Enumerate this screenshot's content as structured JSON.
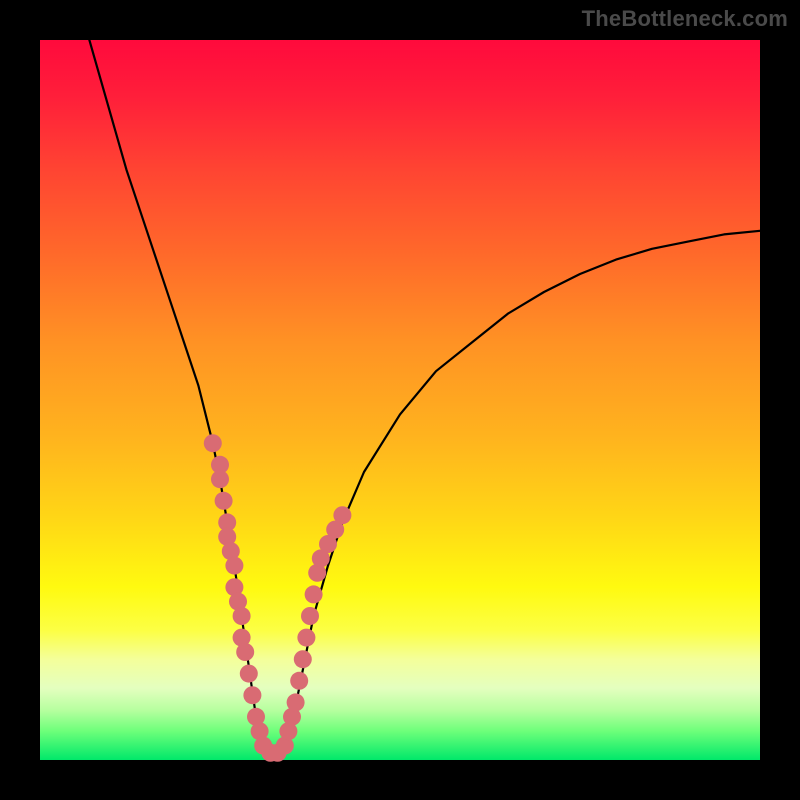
{
  "watermark": "TheBottleneck.com",
  "colors": {
    "background": "#000000",
    "curve": "#000000",
    "dots": "#d96b73",
    "gradient_top": "#ff0a3c",
    "gradient_bottom": "#00e86a"
  },
  "chart_data": {
    "type": "line",
    "title": "",
    "xlabel": "",
    "ylabel": "",
    "xlim": [
      0,
      100
    ],
    "ylim": [
      0,
      100
    ],
    "grid": false,
    "series": [
      {
        "name": "bottleneck-curve",
        "x": [
          6,
          8,
          10,
          12,
          14,
          16,
          18,
          20,
          22,
          24,
          25,
          26,
          27,
          28,
          29,
          30,
          31,
          32,
          33,
          34,
          35,
          36,
          37,
          38,
          40,
          42,
          45,
          50,
          55,
          60,
          65,
          70,
          75,
          80,
          85,
          90,
          95,
          100
        ],
        "values": [
          103,
          96,
          89,
          82,
          76,
          70,
          64,
          58,
          52,
          44,
          39,
          33,
          27,
          20,
          13,
          6,
          2,
          0.5,
          0.5,
          2,
          5,
          10,
          15,
          20,
          27,
          33,
          40,
          48,
          54,
          58,
          62,
          65,
          67.5,
          69.5,
          71,
          72,
          73,
          73.5
        ]
      }
    ],
    "highlight_points": {
      "name": "dots",
      "x": [
        24,
        25,
        25,
        25.5,
        26,
        26,
        26.5,
        27,
        27,
        27.5,
        28,
        28,
        28.5,
        29,
        29.5,
        30,
        30.5,
        31,
        32,
        33,
        34,
        34.5,
        35,
        35.5,
        36,
        36.5,
        37,
        37.5,
        38,
        38.5,
        39,
        40,
        41,
        42
      ],
      "values": [
        44,
        41,
        39,
        36,
        33,
        31,
        29,
        27,
        24,
        22,
        20,
        17,
        15,
        12,
        9,
        6,
        4,
        2,
        1,
        1,
        2,
        4,
        6,
        8,
        11,
        14,
        17,
        20,
        23,
        26,
        28,
        30,
        32,
        34
      ]
    }
  }
}
